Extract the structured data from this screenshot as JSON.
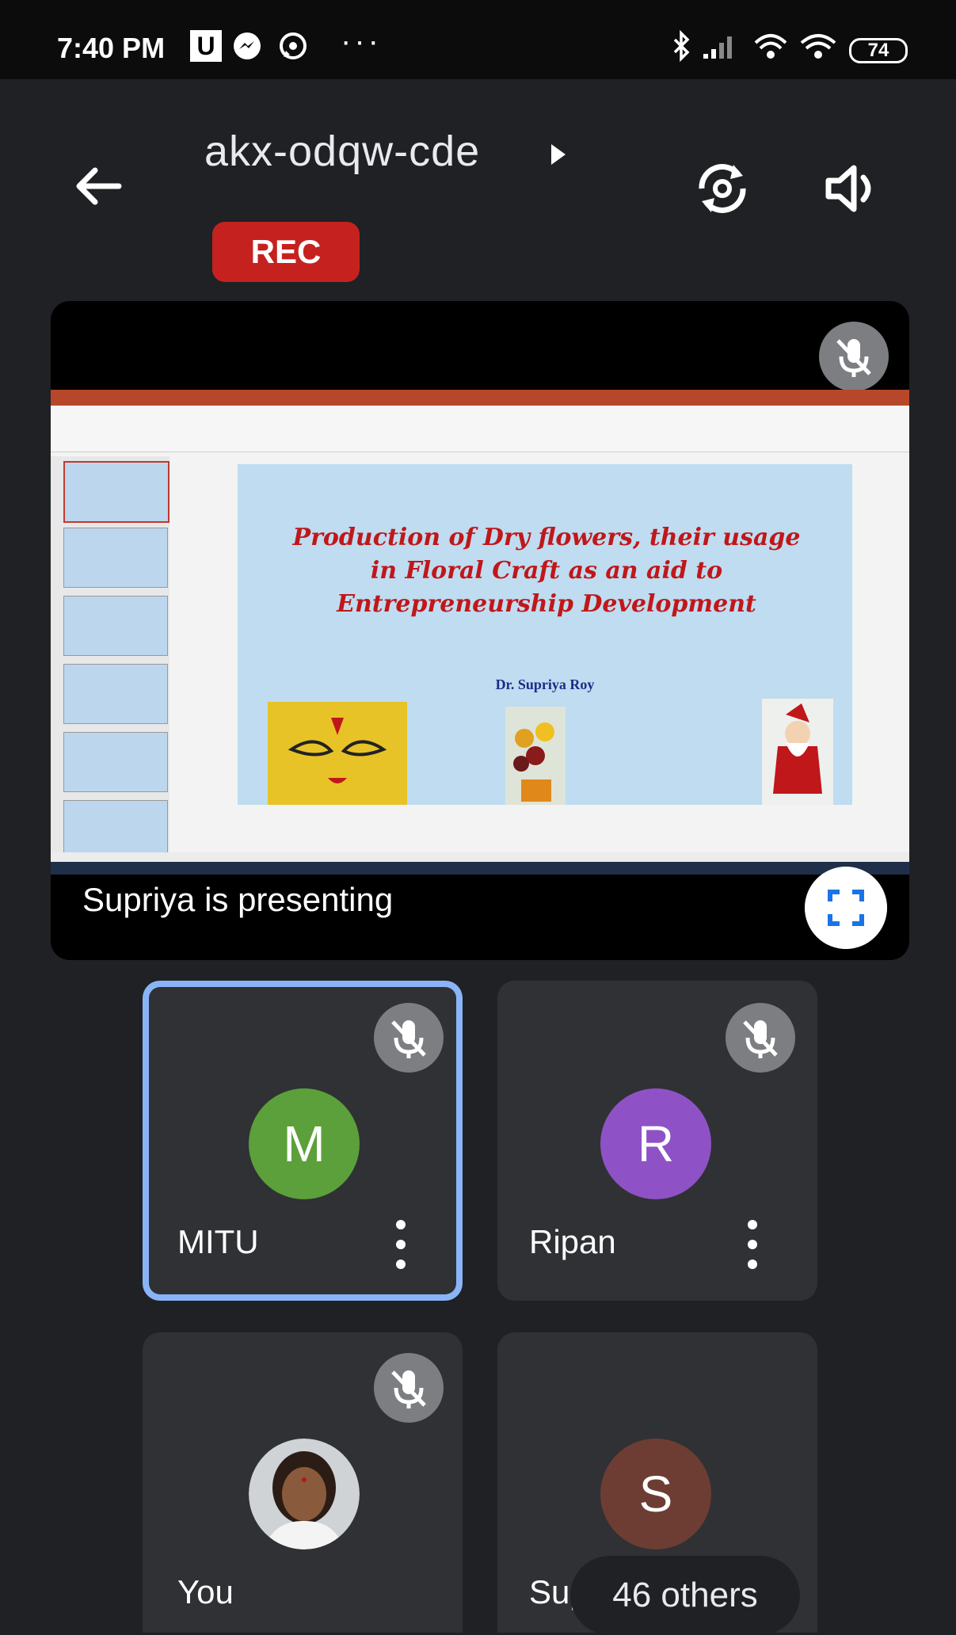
{
  "status_bar": {
    "time": "7:40 PM",
    "u_badge": "U",
    "more_dots": "···",
    "battery": "74",
    "icons": [
      "messenger-icon",
      "whatsapp-icon",
      "bluetooth-icon",
      "signal-icon",
      "wifi-icon",
      "wifi-icon"
    ]
  },
  "header": {
    "meeting_code": "akx-odqw-cde",
    "rec_label": "REC",
    "icons": [
      "back-arrow-icon",
      "caret-right-icon",
      "switch-camera-icon",
      "speaker-icon"
    ]
  },
  "presentation": {
    "status_text": "Supriya is presenting",
    "slide": {
      "title_line1": "Production of Dry flowers, their usage",
      "title_line2": "in Floral Craft as an aid to",
      "title_line3": "Entrepreneurship Development",
      "author": "Dr. Supriya Roy"
    }
  },
  "participants": [
    {
      "initial": "M",
      "name": "MITU",
      "avatar_color": "#5ba03a",
      "selected": true
    },
    {
      "initial": "R",
      "name": "Ripan",
      "avatar_color": "#8e52c6",
      "selected": false
    },
    {
      "initial": "",
      "name": "You",
      "avatar_color": "#d9d9d9",
      "selected": false
    },
    {
      "initial": "S",
      "name": "Supriya",
      "avatar_color": "#6d3d33",
      "selected": false
    }
  ],
  "others_label": "46 others",
  "colors": {
    "background": "#202124",
    "tile": "#303134",
    "selected_border": "#8ab4f8",
    "rec": "#c5221f",
    "slide_title": "#c0171a",
    "slide_author": "#1f2a8a"
  }
}
